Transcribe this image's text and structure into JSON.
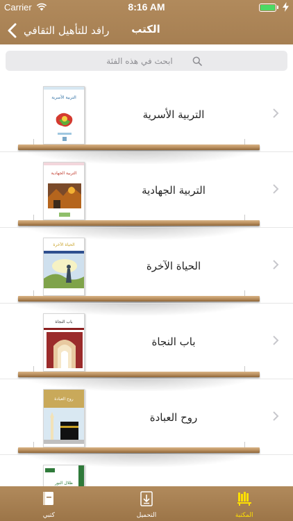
{
  "status_bar": {
    "carrier": "Carrier",
    "time": "8:16 AM",
    "battery_percent": 100
  },
  "nav": {
    "back_label": "رافد للتأهيل الثقافي",
    "title": "الكتب"
  },
  "search": {
    "placeholder": "ابحث في هذه الفئة"
  },
  "books": [
    {
      "title": "التربية الأسرية",
      "cover_caption": "التربية الأسرية"
    },
    {
      "title": "التربية الجهادية",
      "cover_caption": "التربية الجهادية"
    },
    {
      "title": "الحياة الآخرة",
      "cover_caption": "الحياة الآخرة"
    },
    {
      "title": "باب النجاة",
      "cover_caption": "باب النجاة"
    },
    {
      "title": "روح العبادة",
      "cover_caption": "روح العبادة"
    },
    {
      "title": "",
      "cover_caption": "ظلال النور"
    }
  ],
  "tabs": [
    {
      "label": "كتبي",
      "icon": "book-icon",
      "active": false
    },
    {
      "label": "التحميل",
      "icon": "download-icon",
      "active": false
    },
    {
      "label": "المكتبة",
      "icon": "library-icon",
      "active": true
    }
  ],
  "colors": {
    "header": "#a67f52",
    "active_tab": "#ffe000",
    "battery": "#4cd964"
  }
}
